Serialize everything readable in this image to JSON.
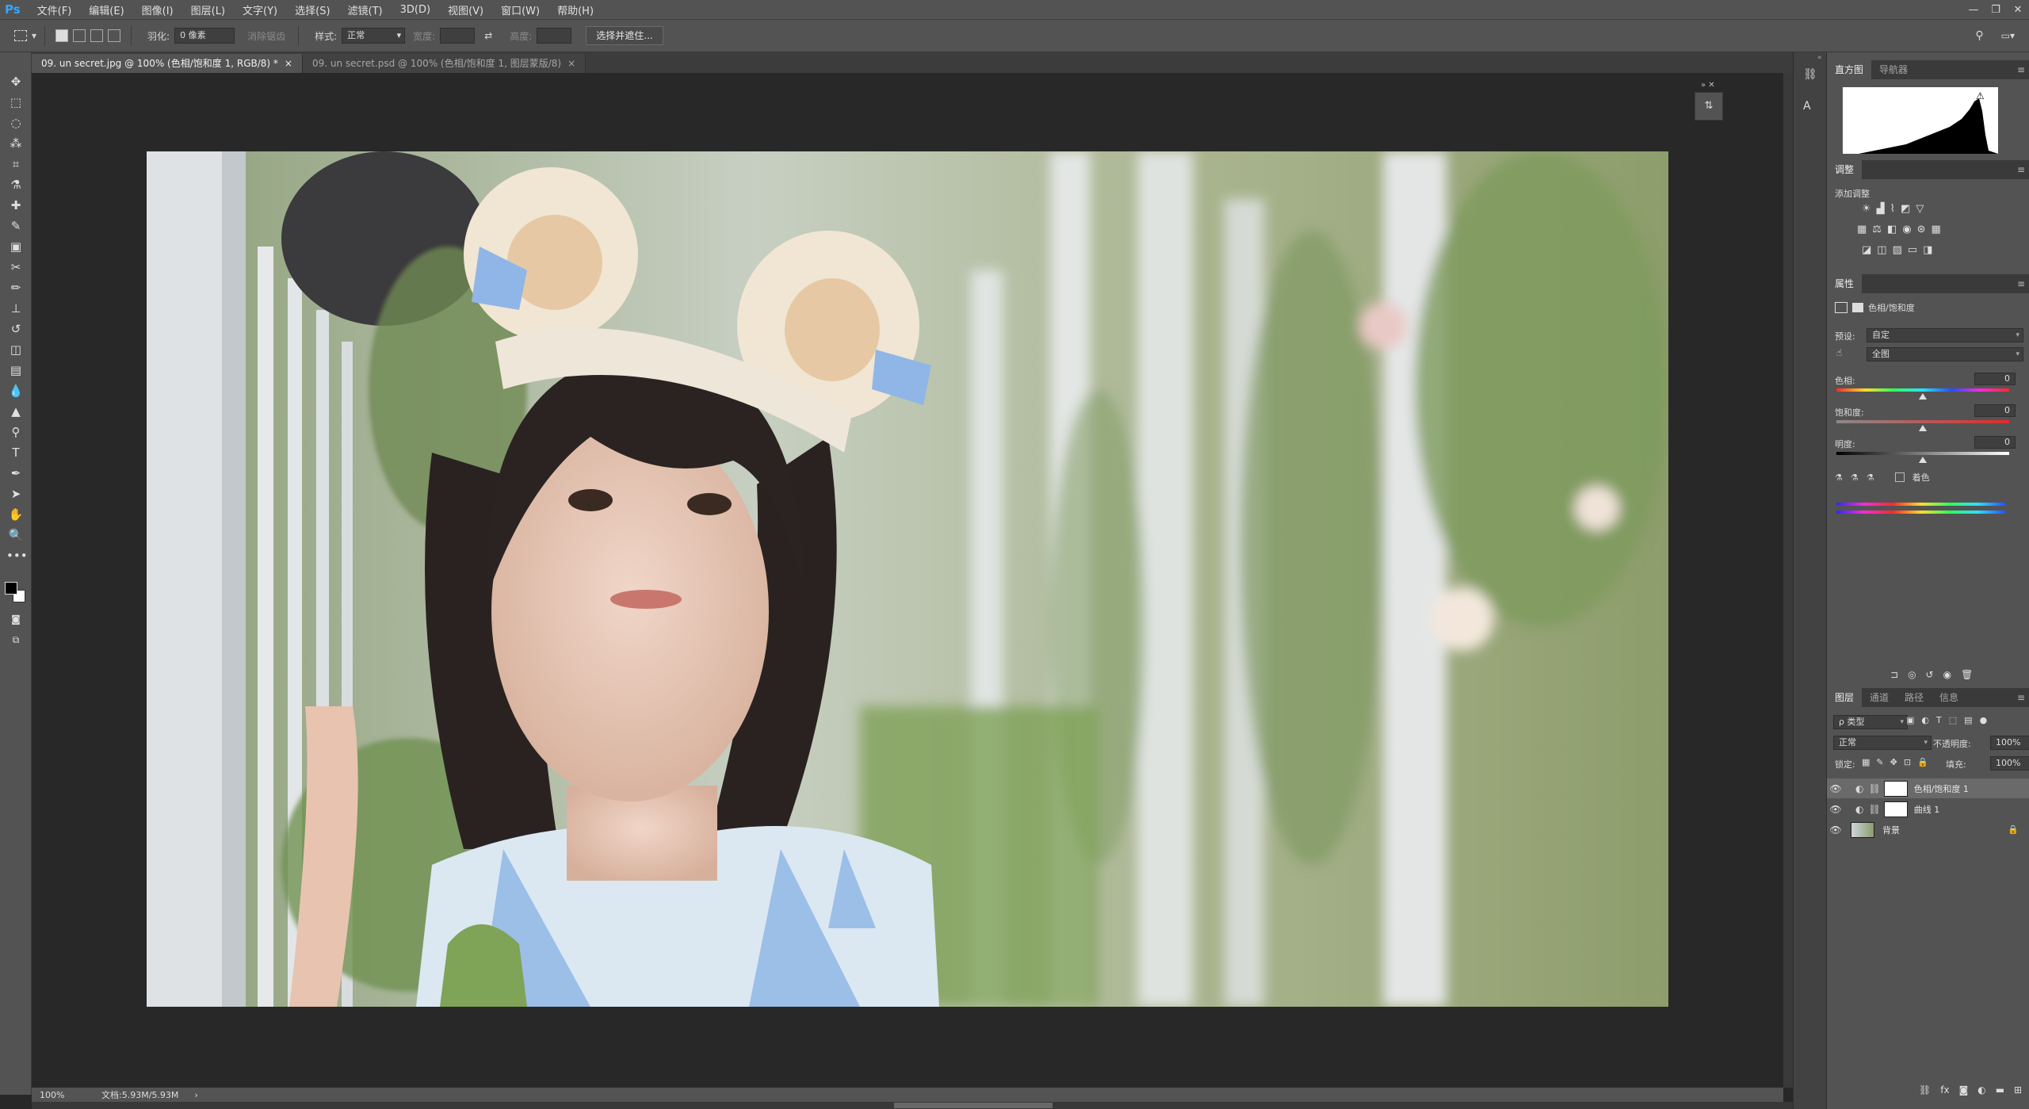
{
  "app": {
    "logo": "Ps"
  },
  "menu": [
    "文件(F)",
    "编辑(E)",
    "图像(I)",
    "图层(L)",
    "文字(Y)",
    "选择(S)",
    "滤镜(T)",
    "3D(D)",
    "视图(V)",
    "窗口(W)",
    "帮助(H)"
  ],
  "window_controls": {
    "minimize": "—",
    "restore": "❐",
    "close": "✕"
  },
  "options": {
    "feather_label": "羽化:",
    "feather_value": "0 像素",
    "antialias_label": "消除锯齿",
    "style_label": "样式:",
    "style_value": "正常",
    "width_label": "宽度:",
    "height_label": "高度:",
    "select_mask_button": "选择并遮住..."
  },
  "tabs": [
    {
      "label": "09. un    secret.jpg @ 100% (色相/饱和度 1, RGB/8) *",
      "close": "×"
    },
    {
      "label": "09. un    secret.psd @ 100% (色相/饱和度 1, 图层蒙版/8)",
      "close": "×"
    }
  ],
  "status": {
    "zoom": "100%",
    "doc": "文档:5.93M/5.93M",
    "arrow": "›"
  },
  "histogram": {
    "tabs": [
      "直方图",
      "导航器"
    ],
    "warning": "⚠"
  },
  "adjustments": {
    "title": "调整",
    "add_label": "添加调整"
  },
  "properties": {
    "title": "属性",
    "panel_name": "色相/饱和度",
    "preset_label": "预设:",
    "preset_value": "自定",
    "channel_value": "全图",
    "hue_label": "色相:",
    "hue_value": "0",
    "saturation_label": "饱和度:",
    "saturation_value": "0",
    "lightness_label": "明度:",
    "lightness_value": "0",
    "colorize_label": "着色",
    "hue_pos": 0.5,
    "sat_pos": 0.5,
    "light_pos": 0.5
  },
  "layers_panel": {
    "tabs": [
      "图层",
      "通道",
      "路径",
      "信息"
    ],
    "filter_label": "ρ 类型",
    "blend_mode": "正常",
    "opacity_label": "不透明度:",
    "opacity_value": "100%",
    "lock_label": "锁定:",
    "fill_label": "填充:",
    "fill_value": "100%",
    "layers": [
      {
        "name": "色相/饱和度 1"
      },
      {
        "name": "曲线 1"
      },
      {
        "name": "背景"
      }
    ]
  },
  "colors": {
    "accent": "#31a8ff",
    "ui_bg": "#535353",
    "canvas_bg": "#282828"
  }
}
